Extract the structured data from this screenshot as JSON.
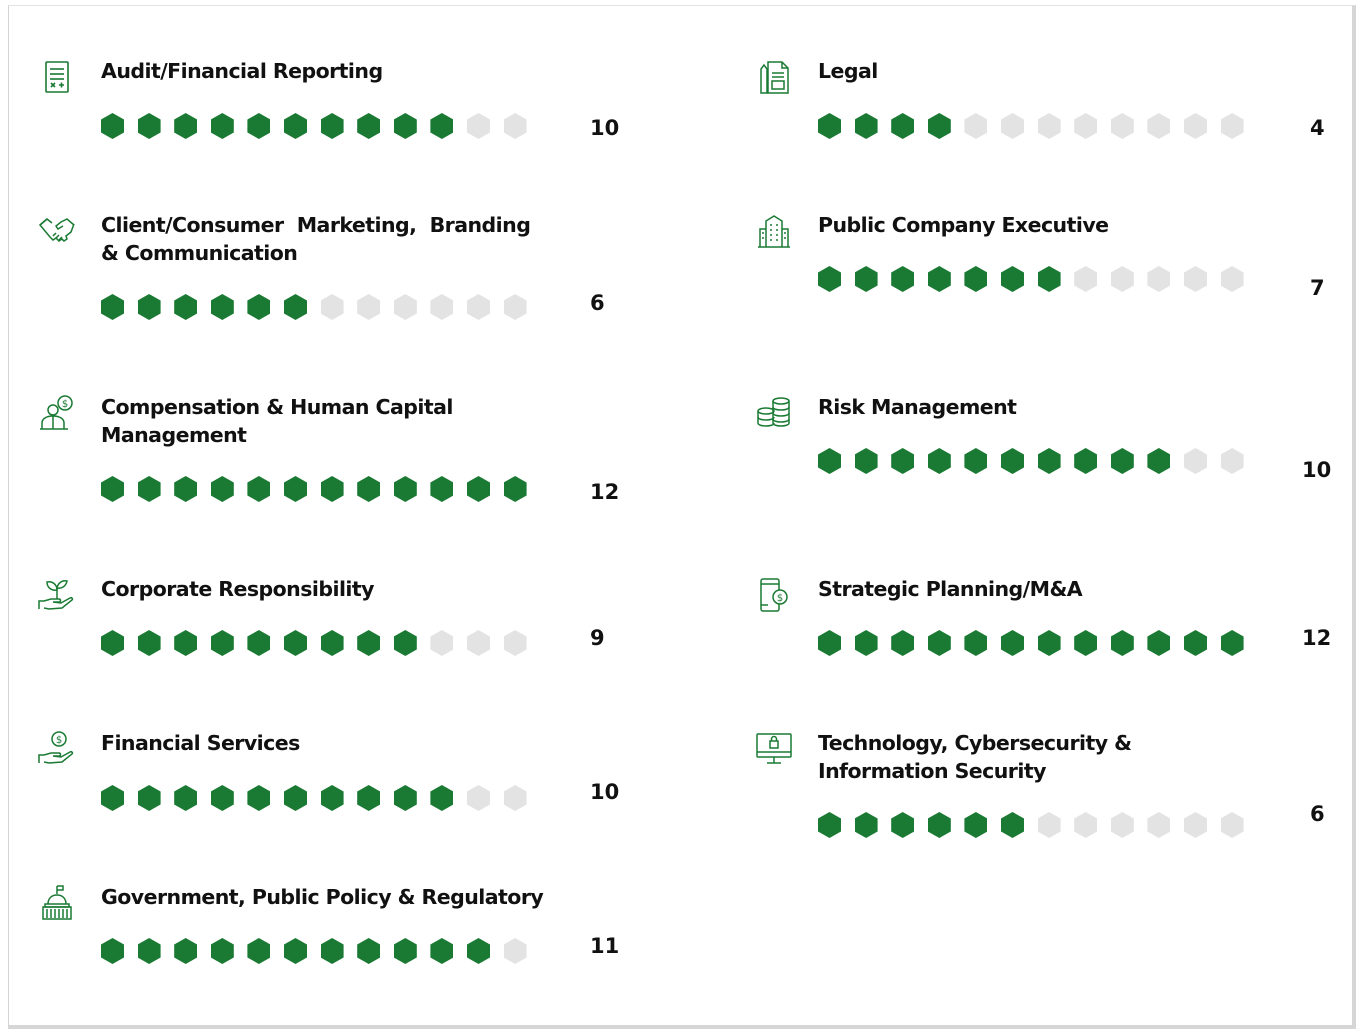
{
  "chart_data": {
    "type": "table",
    "scale_max": 12,
    "colors": {
      "filled": "#1a7a33",
      "empty": "#e3e3e3"
    },
    "skills": [
      {
        "label": "Audit/Financial Reporting",
        "value": 10,
        "icon": "calculator-icon"
      },
      {
        "label": "Client/Consumer  Marketing,  Branding  & Communication",
        "value": 6,
        "icon": "handshake-icon"
      },
      {
        "label": "Compensation & Human Capital Management",
        "value": 12,
        "icon": "employee-dollar-icon"
      },
      {
        "label": "Corporate Responsibility",
        "value": 9,
        "icon": "hand-sprout-icon"
      },
      {
        "label": "Financial Services",
        "value": 10,
        "icon": "hand-dollar-icon"
      },
      {
        "label": "Government, Public Policy & Regulatory",
        "value": 11,
        "icon": "capitol-building-icon"
      },
      {
        "label": "Legal",
        "value": 4,
        "icon": "legal-document-icon"
      },
      {
        "label": "Public Company Executive",
        "value": 7,
        "icon": "office-building-icon"
      },
      {
        "label": "Risk Management",
        "value": 10,
        "icon": "coin-stacks-icon"
      },
      {
        "label": "Strategic Planning/M&A",
        "value": 12,
        "icon": "mobile-dollar-icon"
      },
      {
        "label": "Technology, Cybersecurity & Information Security",
        "value": 6,
        "icon": "monitor-lock-icon"
      }
    ]
  }
}
